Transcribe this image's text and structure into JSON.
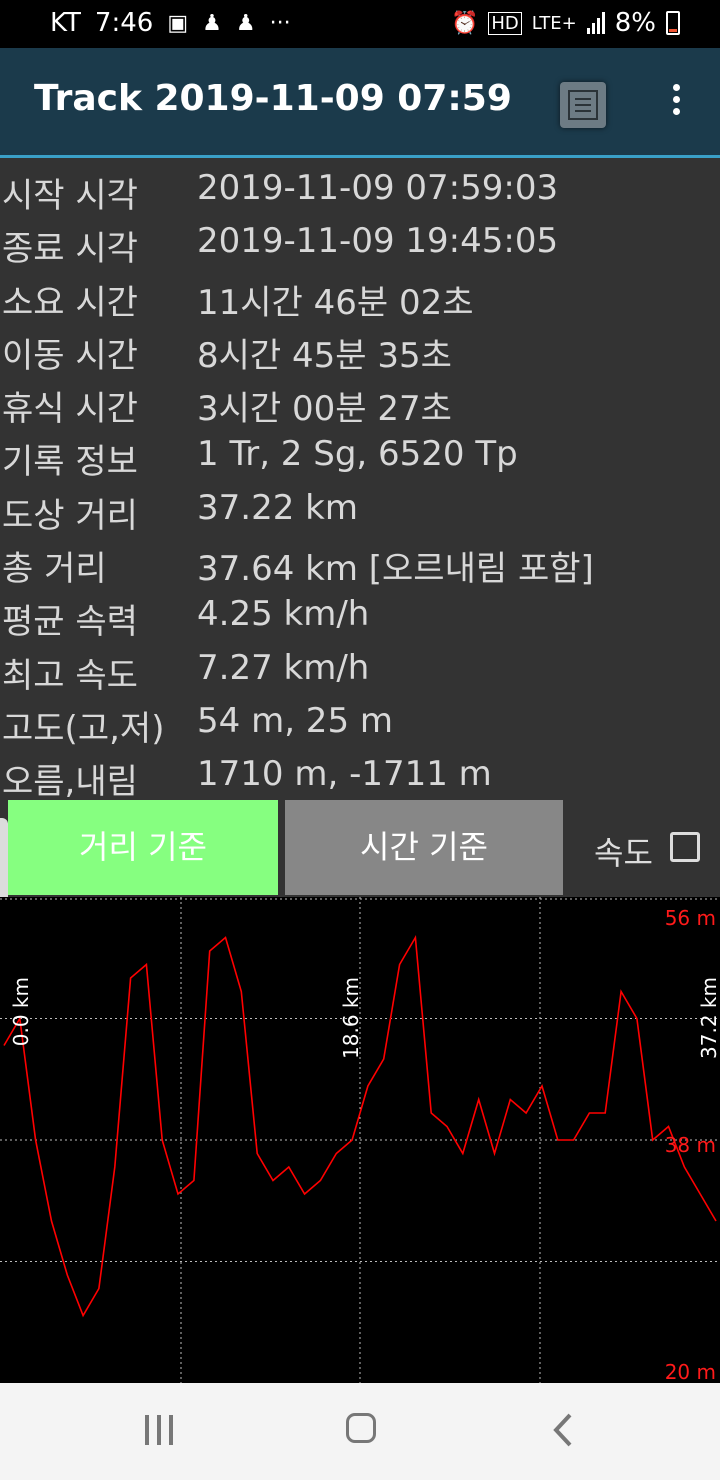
{
  "status_bar": {
    "carrier": "KT",
    "time": "7:46",
    "network": "LTE+",
    "hd": "HD",
    "battery": "8%",
    "more": "···"
  },
  "app_bar": {
    "title": "Track 2019-11-09 07:59"
  },
  "info": [
    {
      "label": "시작 시각",
      "value": "2019-11-09 07:59:03"
    },
    {
      "label": "종료 시각",
      "value": "2019-11-09 19:45:05"
    },
    {
      "label": "소요 시간",
      "value": "11시간 46분 02초"
    },
    {
      "label": "이동 시간",
      "value": "8시간 45분 35초"
    },
    {
      "label": "휴식 시간",
      "value": "3시간 00분 27초"
    },
    {
      "label": "기록 정보",
      "value": "1 Tr, 2 Sg, 6520 Tp"
    },
    {
      "label": "도상 거리",
      "value": "37.22 km"
    },
    {
      "label": "총 거리",
      "value": "37.64 km [오르내림 포함]"
    },
    {
      "label": "평균 속력",
      "value": "4.25 km/h"
    },
    {
      "label": "최고 속도",
      "value": "7.27 km/h"
    },
    {
      "label": "고도(고,저)",
      "value": "54 m, 25 m"
    },
    {
      "label": "오름,내림",
      "value": "1710 m, -1711 m"
    }
  ],
  "controls": {
    "distance_button": "거리 기준",
    "time_button": "시간 기준",
    "speed_label": "속도",
    "speed_checked": false,
    "active_button_color": "#86ff80"
  },
  "chart_data": {
    "type": "line",
    "x_labels": [
      "0.0 km",
      "18.6 km",
      "37.2 km"
    ],
    "x": [
      0,
      1,
      2,
      3,
      4,
      5,
      6,
      7,
      8,
      9,
      10,
      11,
      12,
      13,
      14,
      15,
      16,
      17,
      18,
      19,
      20,
      21,
      22,
      23,
      24,
      25,
      26,
      27,
      28,
      29,
      30,
      31,
      32,
      33,
      34,
      35,
      36,
      37,
      37.2
    ],
    "series": [
      {
        "color": "#ff0000",
        "values": [
          45,
          47,
          38,
          32,
          28,
          25,
          27,
          36,
          50,
          51,
          38,
          34,
          35,
          52,
          53,
          49,
          37,
          35,
          36,
          34,
          35,
          37,
          38,
          42,
          44,
          51,
          53,
          40,
          39,
          37,
          41,
          37,
          41,
          40,
          42,
          38,
          38,
          40,
          40,
          49,
          47,
          38,
          39,
          36,
          34,
          32
        ]
      }
    ],
    "ylim": [
      20,
      56
    ],
    "y_labels": [
      "56 m",
      "38 m",
      "20 m"
    ],
    "line_color": "#ff0000",
    "grid": true
  }
}
